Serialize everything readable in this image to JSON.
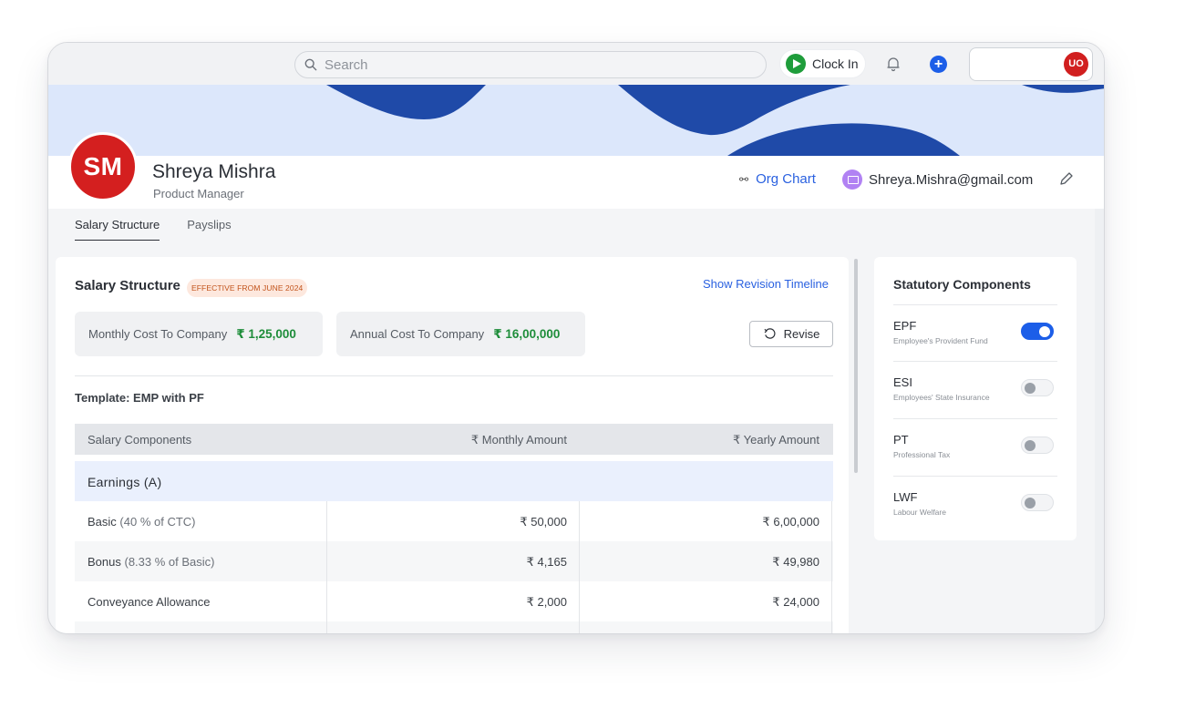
{
  "topbar": {
    "search_placeholder": "Search",
    "clock_in_label": "Clock In",
    "user_initials": "UO"
  },
  "profile": {
    "initials": "SM",
    "name": "Shreya Mishra",
    "role": "Product Manager",
    "org_chart_label": "Org Chart",
    "email": "Shreya.Mishra@gmail.com"
  },
  "tabs": [
    {
      "label": "Salary Structure",
      "active": true
    },
    {
      "label": "Payslips",
      "active": false
    }
  ],
  "salary": {
    "title": "Salary Structure",
    "effective_badge": "EFFECTIVE FROM JUNE 2024",
    "revision_link": "Show Revision Timeline",
    "monthly_ctc_label": "Monthly Cost To Company",
    "monthly_ctc_value": "₹ 1,25,000",
    "annual_ctc_label": "Annual Cost To Company",
    "annual_ctc_value": "₹ 16,00,000",
    "revise_label": "Revise",
    "template_label": "Template: EMP with PF",
    "columns": [
      "Salary Components",
      "₹ Monthly Amount",
      "₹ Yearly Amount"
    ],
    "earnings_label": "Earnings (A)",
    "rows": [
      {
        "name": "Basic",
        "detail": "(40 % of CTC)",
        "monthly": "₹ 50,000",
        "yearly": "₹ 6,00,000"
      },
      {
        "name": "Bonus",
        "detail": "(8.33 % of Basic)",
        "monthly": "₹ 4,165",
        "yearly": "₹ 49,980"
      },
      {
        "name": "Conveyance Allowance",
        "detail": "",
        "monthly": "₹ 2,000",
        "yearly": "₹ 24,000"
      }
    ]
  },
  "statutory": {
    "title": "Statutory Components",
    "items": [
      {
        "name": "EPF",
        "description": "Employee's Provident Fund",
        "enabled": true
      },
      {
        "name": "ESI",
        "description": "Employees' State Insurance",
        "enabled": false
      },
      {
        "name": "PT",
        "description": "Professional Tax",
        "enabled": false
      },
      {
        "name": "LWF",
        "description": "Labour Welfare",
        "enabled": false
      }
    ]
  },
  "colors": {
    "accent_blue": "#1c5ee8",
    "avatar_red": "#d41f1f",
    "ctc_green": "#1e8d3a",
    "banner_bg": "#dce7fb",
    "banner_wave": "#1f4aa8"
  }
}
